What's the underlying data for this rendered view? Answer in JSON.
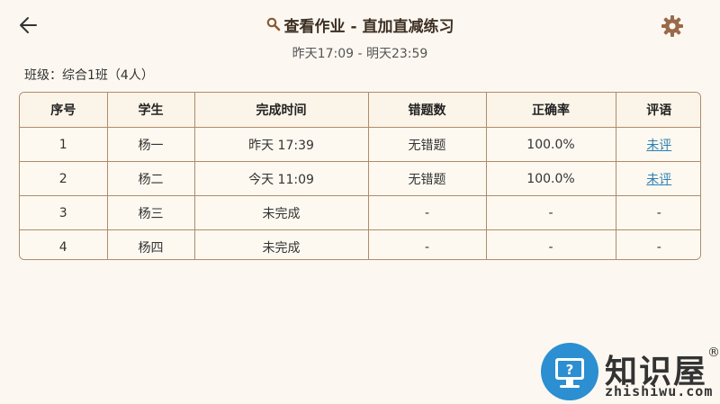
{
  "header": {
    "title": "查看作业 - 直加直减练习",
    "time_range": "昨天17:09 - 明天23:59"
  },
  "class_info": "班级：综合1班（4人）",
  "table": {
    "headers": [
      "序号",
      "学生",
      "完成时间",
      "错题数",
      "正确率",
      "评语"
    ],
    "rows": [
      [
        "1",
        "杨一",
        "昨天 17:39",
        "无错题",
        "100.0%",
        "未评"
      ],
      [
        "2",
        "杨二",
        "今天 11:09",
        "无错题",
        "100.0%",
        "未评"
      ],
      [
        "3",
        "杨三",
        "未完成",
        "-",
        "-",
        "-"
      ],
      [
        "4",
        "杨四",
        "未完成",
        "-",
        "-",
        "-"
      ]
    ]
  },
  "watermark": {
    "name": "知识屋",
    "reg": "®",
    "url": "zhishiwu.com"
  },
  "icons": {
    "back": "arrow-left-icon",
    "search": "magnifier-icon",
    "settings": "gear-icon",
    "logo": "question-monitor-icon"
  },
  "colors": {
    "background": "#fcf8f1",
    "border": "#b08b6a",
    "link": "#2e7fb5",
    "gear": "#9a6a4a",
    "logo_circle": "#2b8fd1"
  }
}
